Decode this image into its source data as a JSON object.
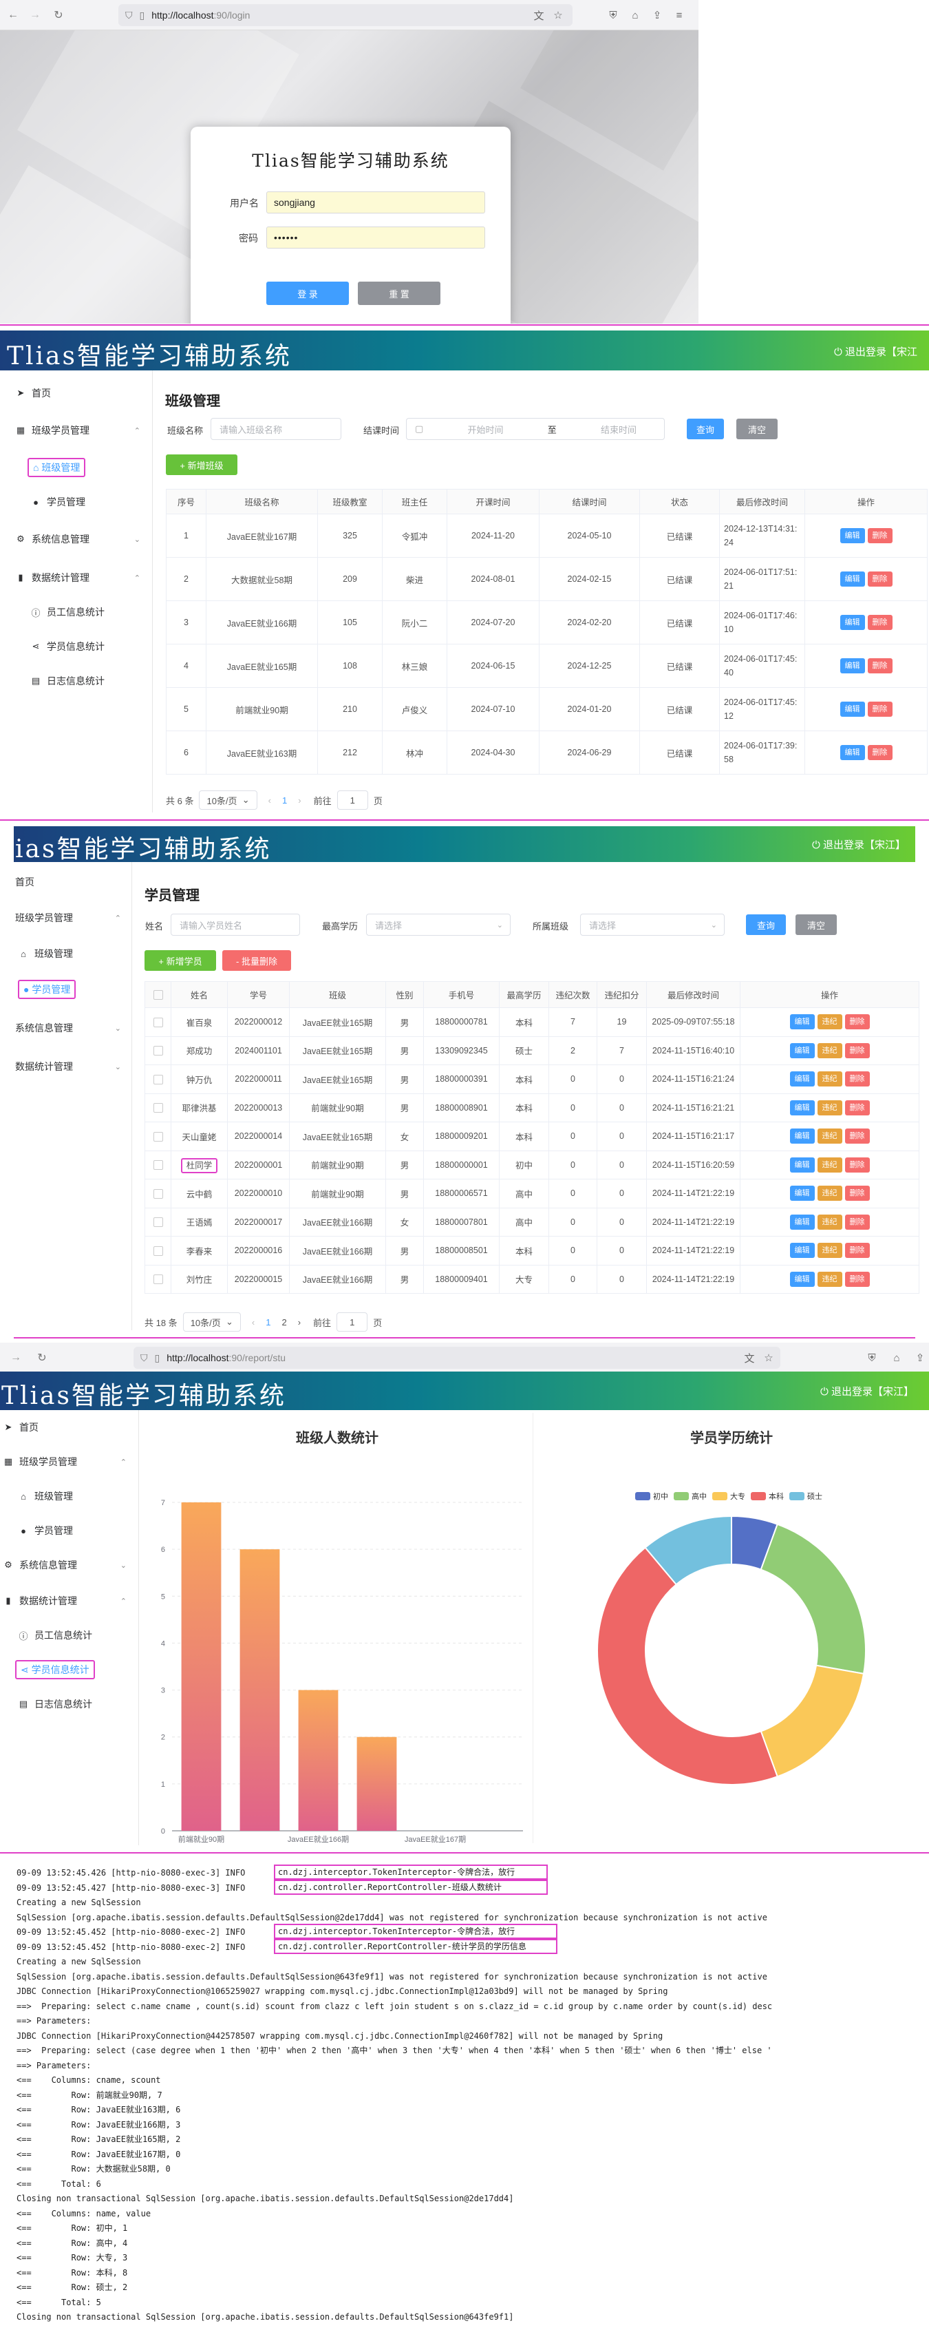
{
  "login": {
    "url_host": "http://localhost",
    "url_path": ":90/login",
    "title": "Tlias智能学习辅助系统",
    "username_label": "用户名",
    "username_value": "songjiang",
    "password_label": "密码",
    "password_value": "••••••",
    "login_button": "登 录",
    "reset_button": "重 置"
  },
  "app": {
    "title": "Tlias智能学习辅助系统",
    "title_cut": "ias智能学习辅助系统",
    "logout": "退出登录【宋江】",
    "logout_cut1": "退出登录【宋江",
    "logout_cut2": "退出登录【宋江】",
    "logout_cut3": "退出登录【宋江】"
  },
  "sidebar": {
    "home": "首页",
    "class_student_mgmt": "班级学员管理",
    "class_mgmt": "班级管理",
    "student_mgmt": "学员管理",
    "system_mgmt": "系统信息管理",
    "stats": "数据统计管理",
    "emp_stats": "员工信息统计",
    "stu_stats": "学员信息统计",
    "log_stats": "日志信息统计"
  },
  "class_page": {
    "title": "班级管理",
    "name_label": "班级名称",
    "name_placeholder": "请输入班级名称",
    "end_label": "结课时间",
    "start_placeholder": "开始时间",
    "to": "至",
    "end_placeholder": "结束时间",
    "query": "查询",
    "clear": "清空",
    "add": "+ 新增班级",
    "columns": [
      "序号",
      "班级名称",
      "班级教室",
      "班主任",
      "开课时间",
      "结课时间",
      "状态",
      "最后修改时间",
      "操作"
    ],
    "rows": [
      [
        "1",
        "JavaEE就业167期",
        "325",
        "令狐冲",
        "2024-11-20",
        "2024-05-10",
        "已结课",
        "2024-12-13T14:31:24"
      ],
      [
        "2",
        "大数据就业58期",
        "209",
        "柴进",
        "2024-08-01",
        "2024-02-15",
        "已结课",
        "2024-06-01T17:51:21"
      ],
      [
        "3",
        "JavaEE就业166期",
        "105",
        "阮小二",
        "2024-07-20",
        "2024-02-20",
        "已结课",
        "2024-06-01T17:46:10"
      ],
      [
        "4",
        "JavaEE就业165期",
        "108",
        "林三娘",
        "2024-06-15",
        "2024-12-25",
        "已结课",
        "2024-06-01T17:45:40"
      ],
      [
        "5",
        "前端就业90期",
        "210",
        "卢俊义",
        "2024-07-10",
        "2024-01-20",
        "已结课",
        "2024-06-01T17:45:12"
      ],
      [
        "6",
        "JavaEE就业163期",
        "212",
        "林冲",
        "2024-04-30",
        "2024-06-29",
        "已结课",
        "2024-06-01T17:39:58"
      ]
    ],
    "edit": "编辑",
    "delete": "删除",
    "total": "共 6 条",
    "page_size": "10条/页",
    "page": "1",
    "goto": "前往",
    "goto_value": "1",
    "page_unit": "页"
  },
  "student_page": {
    "title": "学员管理",
    "name_label": "姓名",
    "name_placeholder": "请输入学员姓名",
    "degree_label": "最高学历",
    "select_placeholder": "请选择",
    "class_label": "所属班级",
    "query": "查询",
    "clear": "清空",
    "add": "+ 新增学员",
    "batch_delete": "- 批量删除",
    "columns": [
      "",
      "姓名",
      "学号",
      "班级",
      "性别",
      "手机号",
      "最高学历",
      "违纪次数",
      "违纪扣分",
      "最后修改时间",
      "操作"
    ],
    "rows": [
      [
        "崔百泉",
        "2022000012",
        "JavaEE就业165期",
        "男",
        "18800000781",
        "本科",
        "7",
        "19",
        "2025-09-09T07:55:18"
      ],
      [
        "郑成功",
        "2024001101",
        "JavaEE就业165期",
        "男",
        "13309092345",
        "硕士",
        "2",
        "7",
        "2024-11-15T16:40:10"
      ],
      [
        "钟万仇",
        "2022000011",
        "JavaEE就业165期",
        "男",
        "18800000391",
        "本科",
        "0",
        "0",
        "2024-11-15T16:21:24"
      ],
      [
        "耶律洪基",
        "2022000013",
        "前端就业90期",
        "男",
        "18800008901",
        "本科",
        "0",
        "0",
        "2024-11-15T16:21:21"
      ],
      [
        "天山童姥",
        "2022000014",
        "JavaEE就业165期",
        "女",
        "18800009201",
        "本科",
        "0",
        "0",
        "2024-11-15T16:21:17"
      ],
      [
        "杜同学",
        "2022000001",
        "前端就业90期",
        "男",
        "18800000001",
        "初中",
        "0",
        "0",
        "2024-11-15T16:20:59"
      ],
      [
        "云中鹤",
        "2022000010",
        "前端就业90期",
        "男",
        "18800006571",
        "高中",
        "0",
        "0",
        "2024-11-14T21:22:19"
      ],
      [
        "王语嫣",
        "2022000017",
        "JavaEE就业166期",
        "女",
        "18800007801",
        "高中",
        "0",
        "0",
        "2024-11-14T21:22:19"
      ],
      [
        "李春来",
        "2022000016",
        "JavaEE就业166期",
        "男",
        "18800008501",
        "本科",
        "0",
        "0",
        "2024-11-14T21:22:19"
      ],
      [
        "刘竹庄",
        "2022000015",
        "JavaEE就业166期",
        "男",
        "18800009401",
        "大专",
        "0",
        "0",
        "2024-11-14T21:22:19"
      ]
    ],
    "edit": "编辑",
    "violation": "违纪",
    "delete": "删除",
    "total": "共 18 条",
    "page_size": "10条/页",
    "pages": [
      "1",
      "2"
    ],
    "goto": "前往",
    "goto_value": "1",
    "page_unit": "页"
  },
  "report_page": {
    "url_host": "http://localhost",
    "url_path": ":90/report/stu"
  },
  "chart_data": [
    {
      "type": "bar",
      "title": "班级人数统计",
      "categories": [
        "前端就业90期",
        "JavaEE就业166期",
        "JavaEE就业165期",
        "JavaEE就业163期",
        "JavaEE就业167期",
        "大数据就业58期"
      ],
      "values": [
        7,
        6,
        3,
        2,
        0,
        0
      ],
      "visible_tick_labels": [
        "前端就业90期",
        "JavaEE就业166期",
        "JavaEE就业167期"
      ],
      "ylim": [
        0,
        7
      ],
      "yticks": [
        "0",
        "1",
        "2",
        "3",
        "4",
        "5",
        "6",
        "7"
      ],
      "colors": {
        "top": "#f9a85a",
        "bottom": "#e0628a"
      }
    },
    {
      "type": "pie",
      "title": "学员学历统计",
      "labels": [
        "初中",
        "高中",
        "大专",
        "本科",
        "硕士"
      ],
      "values": [
        1,
        4,
        3,
        8,
        2
      ],
      "colors": [
        "#5470c6",
        "#91cc75",
        "#fac858",
        "#ee6666",
        "#73c0de"
      ],
      "legend": "top"
    }
  ],
  "log": {
    "lines": [
      "09-09 13:52:45.426 [http-nio-8080-exec-3] INFO  ",
      "09-09 13:52:45.427 [http-nio-8080-exec-3] INFO  ",
      "Creating a new SqlSession",
      "SqlSession [org.apache.ibatis.session.defaults.DefaultSqlSession@2de17dd4] was not registered for synchronization because synchronization is not active",
      "09-09 13:52:45.452 [http-nio-8080-exec-2] INFO  ",
      "09-09 13:52:45.452 [http-nio-8080-exec-2] INFO  ",
      "Creating a new SqlSession",
      "SqlSession [org.apache.ibatis.session.defaults.DefaultSqlSession@643fe9f1] was not registered for synchronization because synchronization is not active",
      "JDBC Connection [HikariProxyConnection@1065259027 wrapping com.mysql.cj.jdbc.ConnectionImpl@12a03bd9] will not be managed by Spring",
      "==>  Preparing: select c.name cname , count(s.id) scount from clazz c left join student s on s.clazz_id = c.id group by c.name order by count(s.id) desc",
      "==> Parameters: ",
      "JDBC Connection [HikariProxyConnection@442578507 wrapping com.mysql.cj.jdbc.ConnectionImpl@2460f782] will not be managed by Spring",
      "==>  Preparing: select (case degree when 1 then '初中' when 2 then '高中' when 3 then '大专' when 4 then '本科' when 5 then '硕士' when 6 then '博士' else '",
      "==> Parameters: ",
      "<==    Columns: cname, scount",
      "<==        Row: 前端就业90期, 7",
      "<==        Row: JavaEE就业163期, 6",
      "<==        Row: JavaEE就业166期, 3",
      "<==        Row: JavaEE就业165期, 2",
      "<==        Row: JavaEE就业167期, 0",
      "<==        Row: 大数据就业58期, 0",
      "<==      Total: 6",
      "Closing non transactional SqlSession [org.apache.ibatis.session.defaults.DefaultSqlSession@2de17dd4]",
      "<==    Columns: name, value",
      "<==        Row: 初中, 1",
      "<==        Row: 高中, 4",
      "<==        Row: 大专, 3",
      "<==        Row: 本科, 8",
      "<==        Row: 硕士, 2",
      "<==      Total: 5",
      "Closing non transactional SqlSession [org.apache.ibatis.session.defaults.DefaultSqlSession@643fe9f1]"
    ],
    "box1a": "cn.dzj.interceptor.TokenInterceptor-令牌合法，放行",
    "box1b": "cn.dzj.controller.ReportController-班级人数统计",
    "box2a": "cn.dzj.interceptor.TokenInterceptor-令牌合法，放行",
    "box2b": "cn.dzj.controller.ReportController-统计学员的学历信息"
  }
}
